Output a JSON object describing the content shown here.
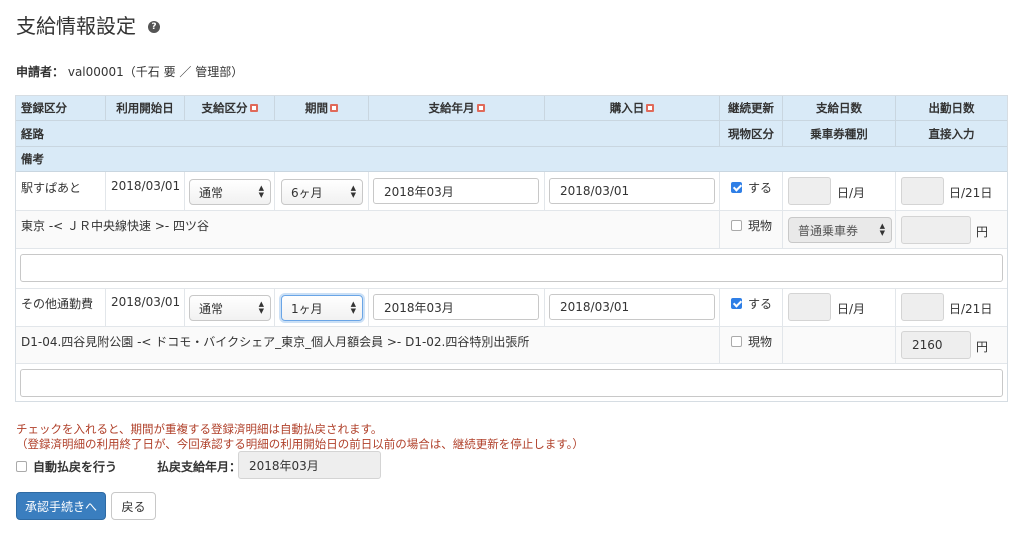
{
  "page": {
    "title": "支給情報設定",
    "help_icon": "question-circle-icon"
  },
  "applicant": {
    "label": "申請者：",
    "value": "val00001（千石 要 ／ 管理部）"
  },
  "table": {
    "header1": [
      "登録区分",
      "利用開始日",
      "支給区分",
      "期間",
      "支給年月",
      "購入日",
      "継続更新",
      "支給日数",
      "出勤日数"
    ],
    "header2": {
      "route": "経路",
      "goods_type": "現物区分",
      "ticket_type": "乗車券種別",
      "direct_input": "直接入力"
    },
    "header3": {
      "remarks": "備考"
    },
    "rows": [
      {
        "type": "駅すぱあと",
        "start_date": "2018/03/01",
        "category": "通常",
        "period": "6ヶ月",
        "pay_month": "2018年03月",
        "purchase_date": "2018/03/01",
        "renew_label": "する",
        "renew_checked": true,
        "days_unit": "日/月",
        "work_unit": "日/21日",
        "route": "東京 -< ＪＲ中央線快速 >- 四ツ谷",
        "goods_label": "現物",
        "goods_checked": false,
        "ticket_type": "普通乗車券",
        "amount_value": "",
        "amount_unit": "円",
        "remarks": ""
      },
      {
        "type": "その他通勤費",
        "start_date": "2018/03/01",
        "category": "通常",
        "period": "1ヶ月",
        "pay_month": "2018年03月",
        "purchase_date": "2018/03/01",
        "renew_label": "する",
        "renew_checked": true,
        "days_unit": "日/月",
        "work_unit": "日/21日",
        "route": "D1-04.四谷見附公園 -< ドコモ・バイクシェア_東京_個人月額会員 >- D1-02.四谷特別出張所",
        "goods_label": "現物",
        "goods_checked": false,
        "ticket_type": "",
        "amount_value": "2160",
        "amount_unit": "円",
        "remarks": ""
      }
    ]
  },
  "notice": {
    "line1": "チェックを入れると、期間が重複する登録済明細は自動払戻されます。",
    "line2": "（登録済明細の利用終了日が、今回承認する明細の利用開始日の前日以前の場合は、継続更新を停止します。）"
  },
  "auto_refund": {
    "label": "自動払戻を行う",
    "checked": false
  },
  "refund_month": {
    "label": "払戻支給年月：",
    "value": "2018年03月"
  },
  "buttons": {
    "approve": "承認手続きへ",
    "back": "戻る"
  },
  "colors": {
    "header_bg": "#d9eaf7",
    "primary": "#3a7ebf",
    "warning_text": "#b0402a",
    "checkbox_on": "#2f7fe6"
  }
}
